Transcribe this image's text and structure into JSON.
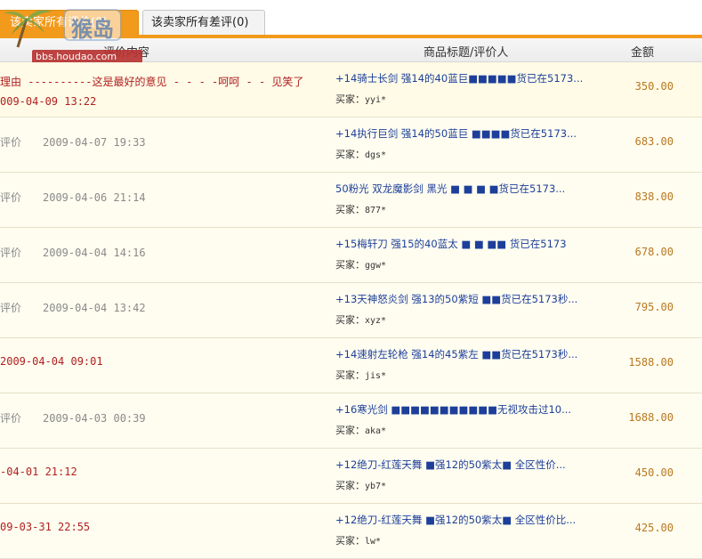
{
  "tabs": [
    {
      "label": "该卖家所有评价(0)",
      "active": true
    },
    {
      "label": "该卖家所有差评(0)",
      "active": false
    }
  ],
  "watermark": {
    "brand": "猴岛",
    "url": "bbs.houdao.com"
  },
  "table": {
    "headers": {
      "content": "评价内容",
      "title": "商品标题/评价人",
      "amount": "金额"
    },
    "buyer_prefix": "买家：",
    "rows": [
      {
        "left": "理由 ----------这是最好的意见 - - - -呵呵 - - 见笑了",
        "left2": "009-04-09 13:22",
        "style": "red",
        "title": "+14骑士长剑 强14的40蓝巨■■■■■货已在5173...",
        "buyer": "yyi*",
        "amount": "350.00"
      },
      {
        "kind": "评价",
        "time": "2009-04-07 19:33",
        "style": "gray",
        "title": "+14执行巨剑 强14的50蓝巨 ■■■■货已在5173...",
        "buyer": "dgs*",
        "amount": "683.00"
      },
      {
        "kind": "评价",
        "time": "2009-04-06 21:14",
        "style": "gray",
        "title": "50粉光 双龙魔影剑 黑光 ■ ■ ■ ■货已在5173...",
        "buyer": "877*",
        "amount": "838.00"
      },
      {
        "kind": "评价",
        "time": "2009-04-04 14:16",
        "style": "gray",
        "title": "+15梅轩刀 强15的40蓝太 ■ ■ ■■ 货已在5173",
        "buyer": "ggw*",
        "amount": "678.00"
      },
      {
        "kind": "评价",
        "time": "2009-04-04 13:42",
        "style": "gray",
        "title": "+13天神怒炎剑 强13的50紫短 ■■货已在5173秒...",
        "buyer": "xyz*",
        "amount": "795.00"
      },
      {
        "kind": "",
        "time": "2009-04-04 09:01",
        "style": "red",
        "title": "+14速射左轮枪 强14的45紫左 ■■货已在5173秒...",
        "buyer": "jis*",
        "amount": "1588.00"
      },
      {
        "kind": "评价",
        "time": "2009-04-03 00:39",
        "style": "gray",
        "title": "+16寒光剑 ■■■■■■■■■■■无视攻击过10...",
        "buyer": "aka*",
        "amount": "1688.00"
      },
      {
        "kind": "",
        "time": "-04-01 21:12",
        "style": "red",
        "title": "+12绝刀-红莲天舞 ■强12的50紫太■ 全区性价...",
        "buyer": "yb7*",
        "amount": "450.00"
      },
      {
        "kind": "",
        "time": "09-03-31 22:55",
        "style": "red",
        "title": "+12绝刀-红莲天舞 ■强12的50紫太■ 全区性价比...",
        "buyer": "lw*",
        "amount": "425.00"
      }
    ]
  }
}
